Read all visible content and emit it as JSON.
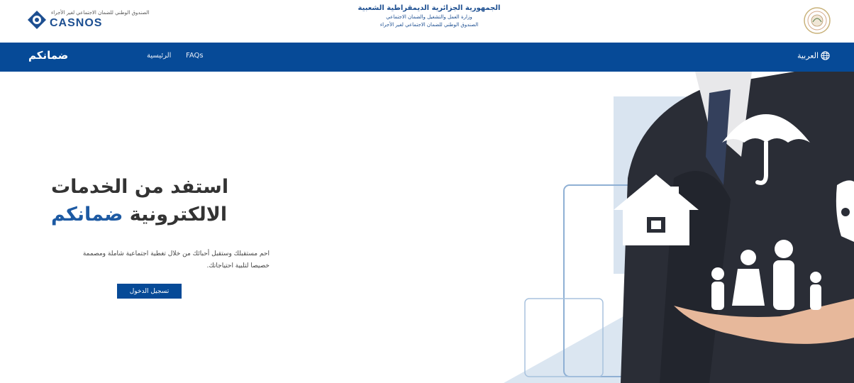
{
  "header": {
    "logo_small_text": "الصندوق الوطني للضمان الاجتماعي لغير الأجراء",
    "logo_name": "CASNOS",
    "gov_line1": "الجمهورية الجزائرية الديمقراطية الشعبية",
    "gov_line2": "وزارة العمل والتشغيل والضمان الاجتماعي",
    "gov_line3": "الصندوق الوطني للضمان الاجتماعي لغير الأجراء"
  },
  "nav": {
    "brand": "ضمانكم",
    "links": [
      "الرئيسية",
      "FAQs"
    ],
    "language": "العربية"
  },
  "hero": {
    "title_line1": "استفد من الخدمات",
    "title_line2_a": "الالكترونية",
    "title_line2_b": "ضمانكم",
    "description": "احم مستقبلك وستقبل أحبائك من خلال تغطية اجتماعية شاملة ومصممة خصيصا لتلبية احتياجاتك.",
    "cta_label": "تسجيل الدخول"
  },
  "colors": {
    "brand_blue": "#064a97",
    "accent_blue": "#1d5aa3"
  },
  "icons": [
    "globe-icon",
    "umbrella-icon",
    "house-icon",
    "family-icon"
  ]
}
